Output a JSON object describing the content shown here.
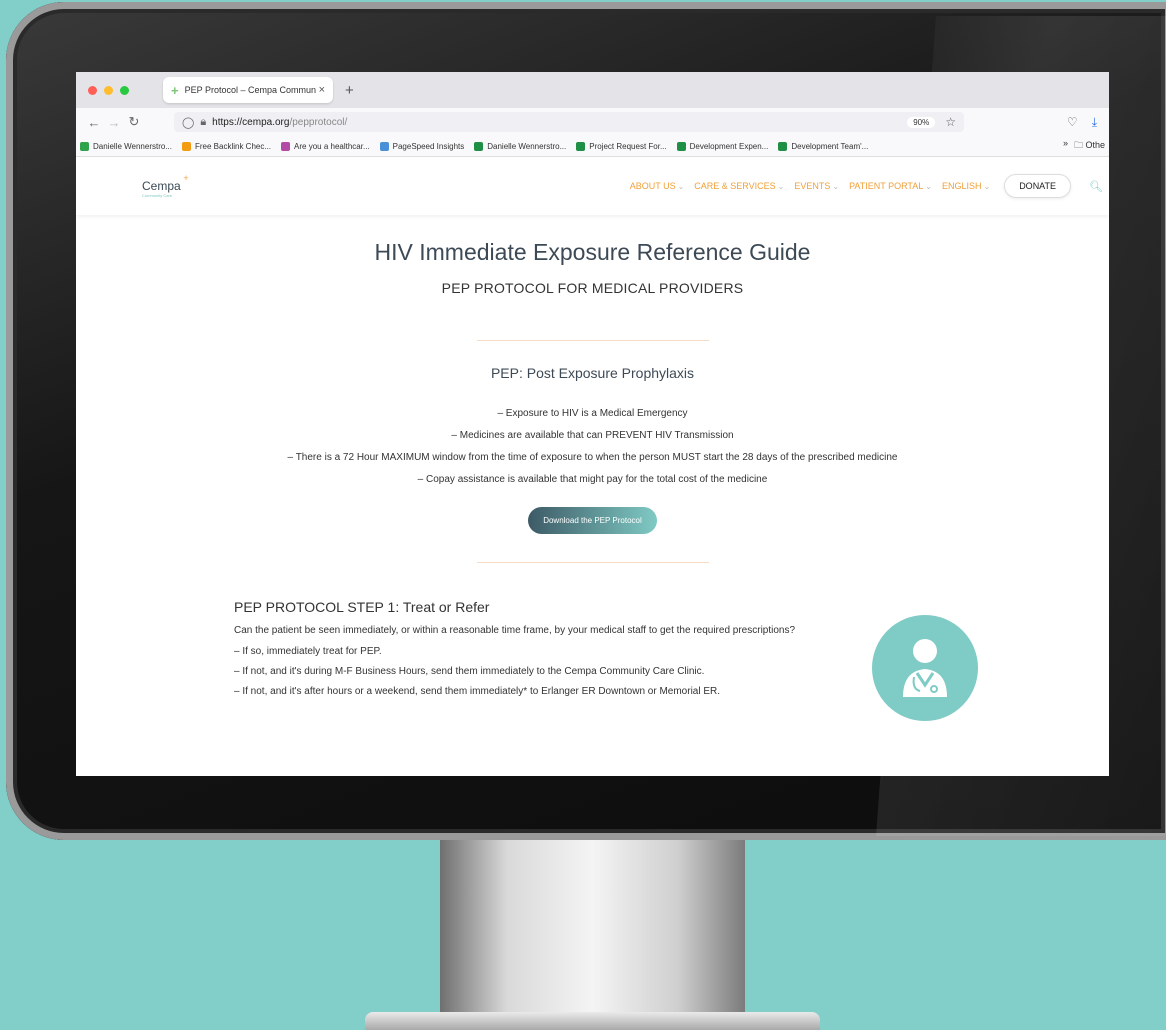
{
  "browser": {
    "tab_title": "PEP Protocol – Cempa Commun",
    "tab_close": "×",
    "new_tab": "+",
    "url_host": "https://cempa.org",
    "url_path": "/pepprotocol/",
    "zoom": "90%",
    "bookmarks": [
      {
        "label": "Danielle Wennerstro...",
        "color": "#2fa24c"
      },
      {
        "label": "Free Backlink Chec...",
        "color": "#f39c12"
      },
      {
        "label": "Are you a healthcar...",
        "color": "#b24aa6"
      },
      {
        "label": "PageSpeed Insights",
        "color": "#4a90d9"
      },
      {
        "label": "Danielle Wennerstro...",
        "color": "#1f8f45"
      },
      {
        "label": "Project Request For...",
        "color": "#1f8f45"
      },
      {
        "label": "Development Expen...",
        "color": "#1f8f45"
      },
      {
        "label": "Development Team'...",
        "color": "#1f8f45"
      }
    ],
    "bookmarks_overflow": "»",
    "other_bookmarks": "Othe"
  },
  "site": {
    "logo": "Cempa",
    "logo_sub": "Community Care",
    "menu": [
      "ABOUT US",
      "CARE & SERVICES",
      "EVENTS",
      "PATIENT PORTAL",
      "ENGLISH"
    ],
    "donate": "DONATE"
  },
  "page": {
    "title": "HIV Immediate Exposure Reference Guide",
    "subtitle": "PEP PROTOCOL FOR MEDICAL PROVIDERS",
    "section_title": "PEP: Post Exposure Prophylaxis",
    "bullets": [
      "– Exposure to HIV is a Medical Emergency",
      "– Medicines are available that can PREVENT HIV Transmission",
      "– There is a 72 Hour MAXIMUM window from the time of exposure to when the person MUST start the 28 days of the prescribed medicine",
      "– Copay assistance is available that might pay for the total cost of the medicine"
    ],
    "download_button": "Download the PEP Protocol",
    "step1": {
      "title": "PEP PROTOCOL STEP 1: Treat or Refer",
      "question": "Can the patient be seen immediately, or within a reasonable time frame, by your medical staff to get the required prescriptions?",
      "items": [
        "– If so, immediately treat for PEP.",
        "– If not, and it's during M-F Business Hours, send them immediately to the Cempa Community Care Clinic.",
        "– If not, and it's after hours or a weekend, send them immediately* to Erlanger ER Downtown or Memorial ER."
      ]
    }
  },
  "colors": {
    "accent_teal": "#7fcbc5",
    "menu_orange": "#f0a03a",
    "background": "#82cfca"
  }
}
